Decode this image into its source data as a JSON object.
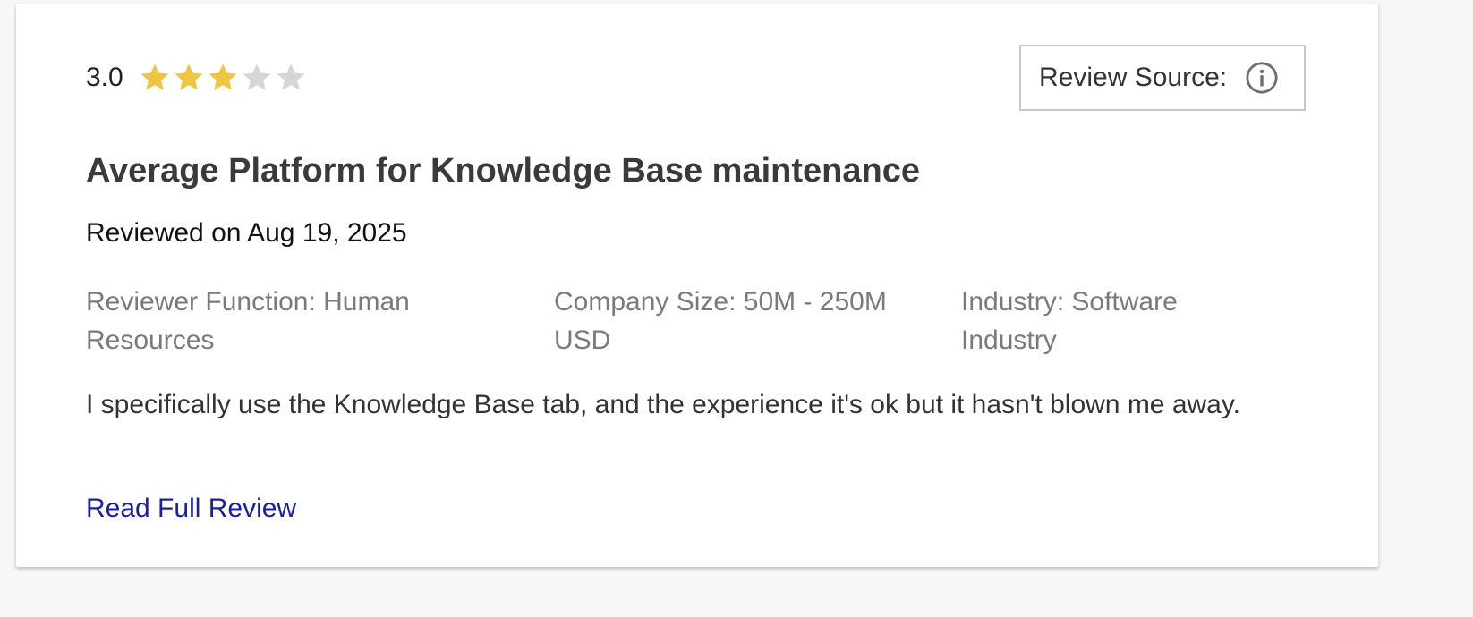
{
  "review": {
    "rating_text": "3.0",
    "rating_value": 3,
    "rating_max": 5,
    "star_color_filled": "#f0c542",
    "star_color_empty": "#d6d6d6",
    "source_label": "Review Source:",
    "source_icon": "info-icon",
    "title": "Average Platform for Knowledge Base maintenance",
    "reviewed_on": "Reviewed on Aug 19, 2025",
    "meta": {
      "function": "Reviewer Function: Human Resources",
      "company_size": "Company Size: 50M - 250M USD",
      "industry": "Industry: Software Industry"
    },
    "body": "I specifically use the Knowledge Base tab, and the experience it's ok but it hasn't blown me away.",
    "read_more_label": "Read Full Review",
    "link_color": "#1a1fa8"
  }
}
